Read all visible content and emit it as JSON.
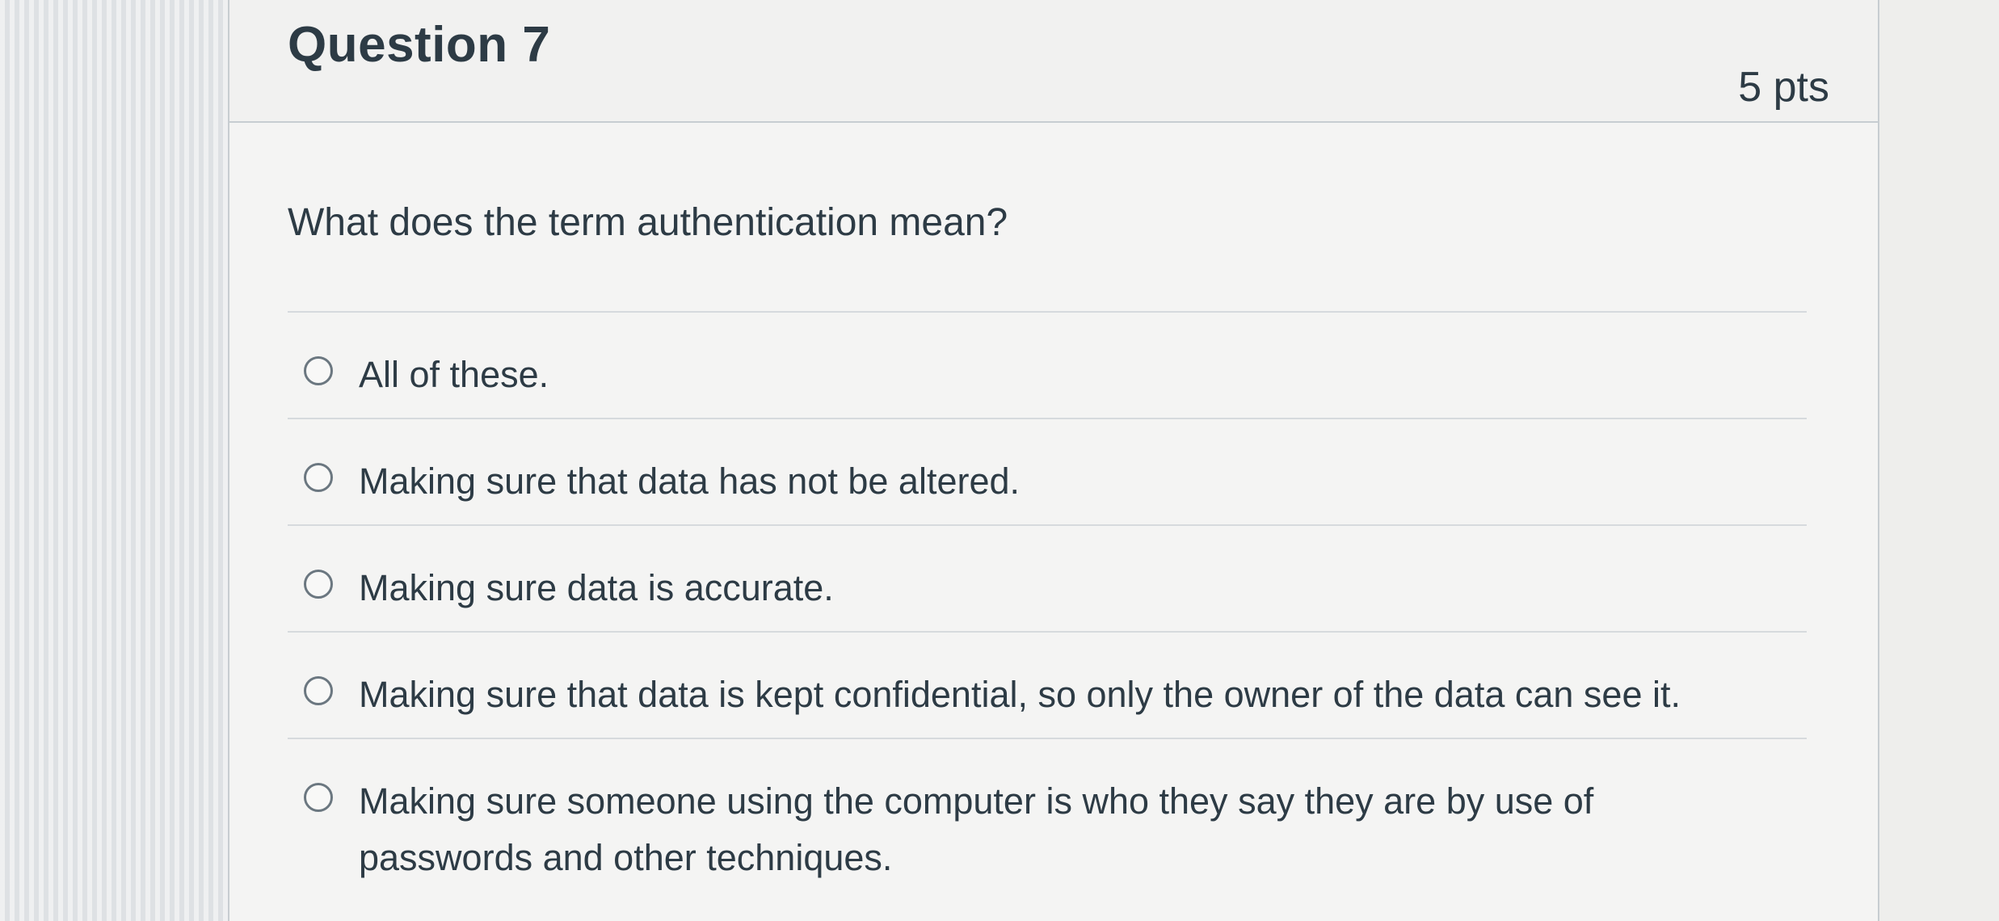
{
  "question": {
    "title": "Question 7",
    "points": "5 pts",
    "text": "What does the term authentication mean?"
  },
  "answers": [
    {
      "label": "All of these."
    },
    {
      "label": "Making sure that data has not be altered."
    },
    {
      "label": "Making sure data is accurate."
    },
    {
      "label": "Making sure that data is kept confidential, so only the owner of the data can see it."
    },
    {
      "label": "Making sure someone using the computer is who they say they are by use of passwords and other techniques."
    }
  ]
}
